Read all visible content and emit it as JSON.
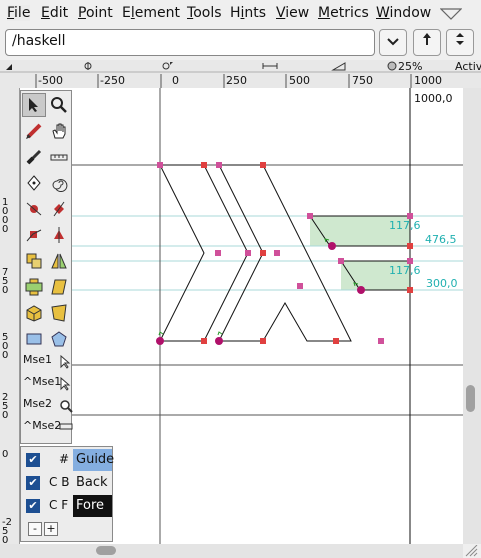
{
  "menu": [
    "File",
    "Edit",
    "Point",
    "Element",
    "Tools",
    "Hints",
    "View",
    "Metrics",
    "Window"
  ],
  "menu_underline": [
    "F",
    "E",
    "P",
    "l",
    "T",
    "i",
    "V",
    "M",
    "W"
  ],
  "glyph_name": "/haskell",
  "nav_buttons": [
    "chevron-down-icon",
    "prev-glyph-icon",
    "next-glyph-icon"
  ],
  "ruler": {
    "top_labels": [
      "-500",
      "-250",
      "0",
      "250",
      "500",
      "750",
      "1000"
    ],
    "zoom": "25%",
    "active_text": "Activ",
    "left_labels": [
      "1000",
      "750",
      "500",
      "250",
      "0",
      "-250"
    ]
  },
  "canvas": {
    "advance_label": "1000,0",
    "guide_labels": [
      "117,6",
      "476,5",
      "117,6",
      "300,0"
    ]
  },
  "tools": {
    "mouse_labels": [
      "Mse1",
      "^Mse1",
      "Mse2",
      "^Mse2"
    ]
  },
  "layers": [
    {
      "checked": true,
      "cb": "#",
      "name": "Guide",
      "style": "guide"
    },
    {
      "checked": true,
      "cb": "C B",
      "name": "Back",
      "style": "back"
    },
    {
      "checked": true,
      "cb": "C F",
      "name": "Fore",
      "style": "fore"
    }
  ],
  "layer_buttons": [
    "-",
    "+"
  ],
  "colors": {
    "point_pink": "#d0509a",
    "point_red": "#e04040",
    "oncurve_magenta": "#b0106a",
    "guide_label": "#20b0b0",
    "hint_fill": "#cfe8cf",
    "guide_selected_bg": "#84aee0",
    "fore_bg": "#111111"
  }
}
